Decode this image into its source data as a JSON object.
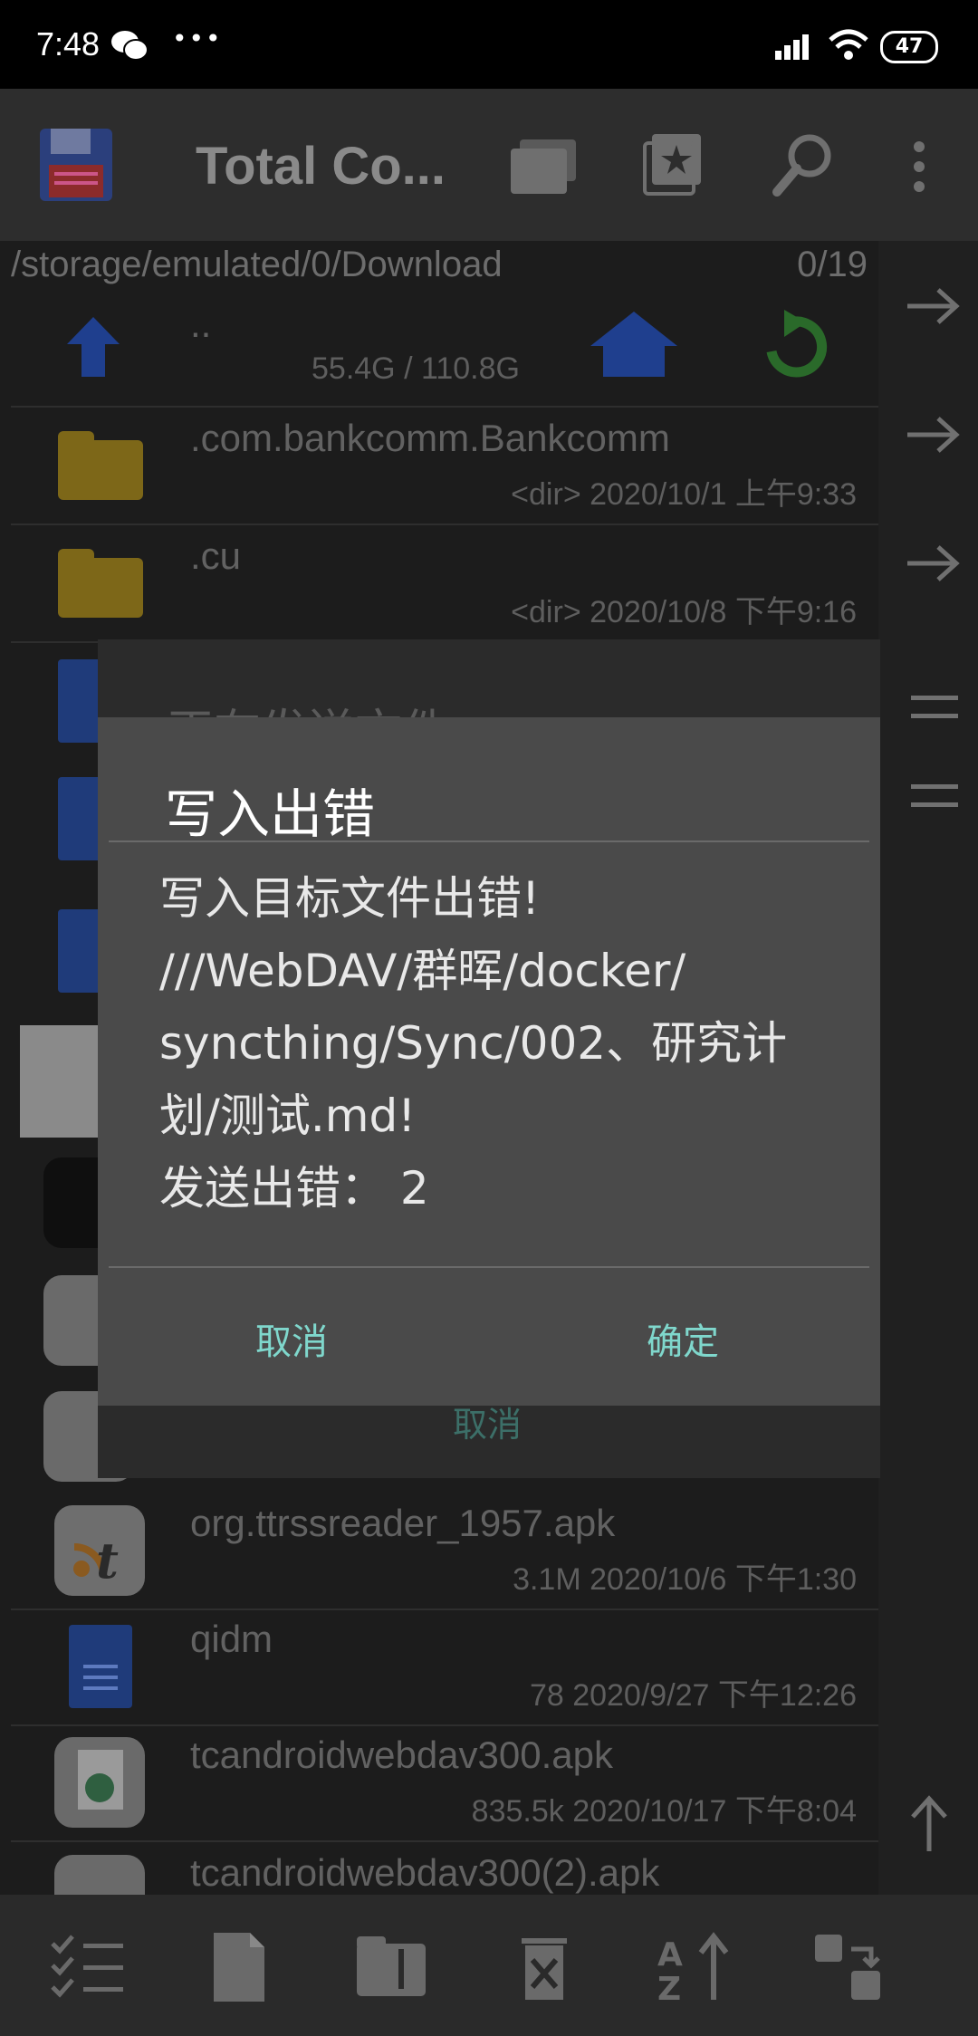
{
  "status_bar": {
    "time": "7:48",
    "battery": "47",
    "dots": "•••"
  },
  "toolbar": {
    "title": "Total Co..."
  },
  "path": {
    "current": "/storage/emulated/0/Download",
    "count": "0/19"
  },
  "storage": {
    "parent": "..",
    "usage": "55.4G / 110.8G"
  },
  "files": [
    {
      "name": ".com.bankcomm.Bankcomm",
      "meta": "<dir>  2020/10/1  上午9:33",
      "icon": "folder-icon"
    },
    {
      "name": ".cu",
      "meta": "<dir>  2020/10/8  下午9:16",
      "icon": "folder-icon"
    },
    {
      "name": "org.ttrssreader_1957.apk",
      "meta": "3.1M  2020/10/6  下午1:30",
      "icon": "ttrss-app-icon"
    },
    {
      "name": "qidm",
      "meta": "78  2020/9/27  下午12:26",
      "icon": "document-icon"
    },
    {
      "name": "tcandroidwebdav300.apk",
      "meta": "835.5k  2020/10/17  下午8:04",
      "icon": "webdav-app-icon"
    },
    {
      "name": "tcandroidwebdav300(2).apk",
      "meta": "",
      "icon": "webdav-app-icon"
    }
  ],
  "progress_dialog": {
    "title": "正在发送文件...",
    "cancel": "取消"
  },
  "error_dialog": {
    "title": "写入出错",
    "line1": "写入目标文件出错!",
    "line2": "///WebDAV/群晖/docker/",
    "line3": "syncthing/Sync/002、研究计",
    "line4": "划/测试.md!",
    "line5": "发送出错： 2",
    "cancel": "取消",
    "ok": "确定"
  },
  "colors": {
    "accent": "#7fd7cc",
    "dialog_bg": "#4a4a4a"
  }
}
